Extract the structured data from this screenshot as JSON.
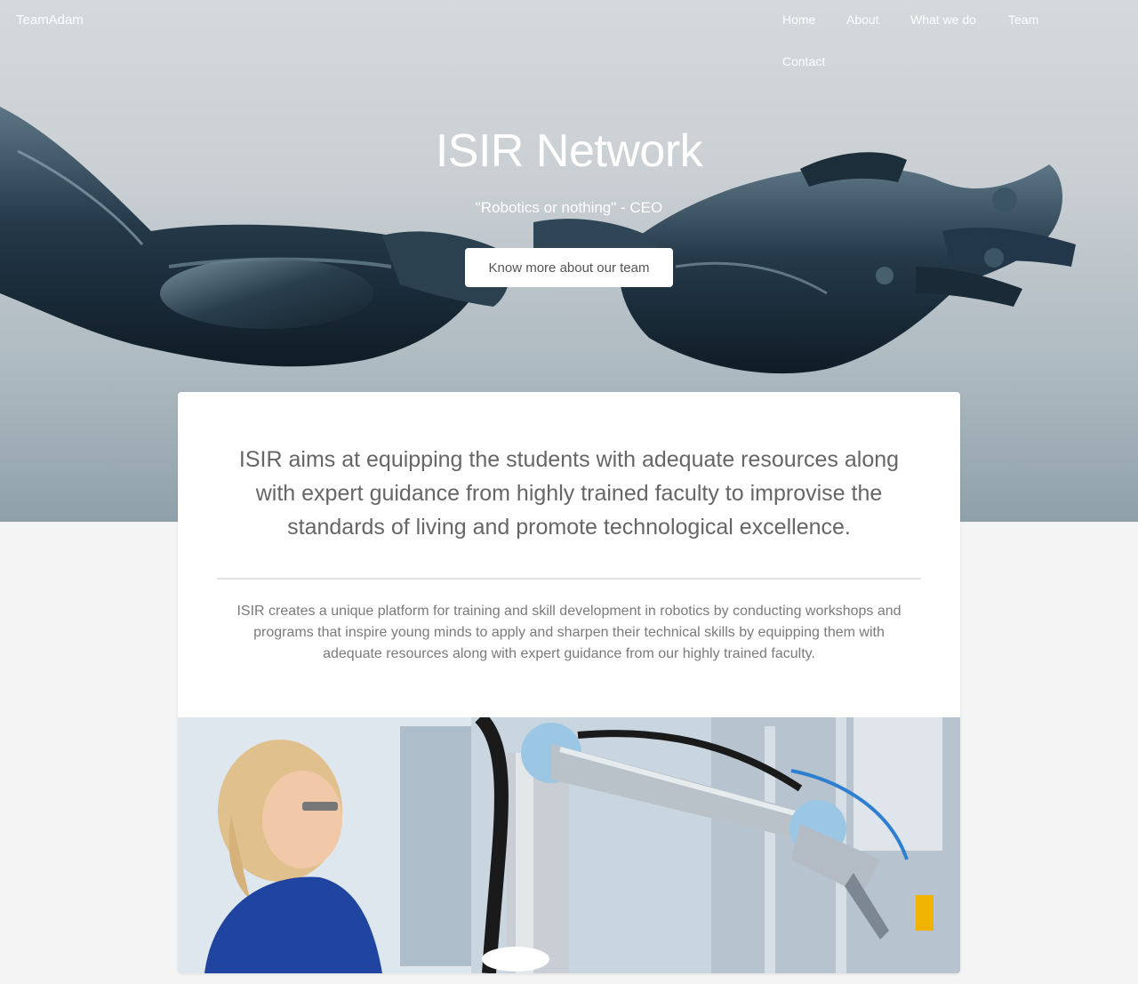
{
  "header": {
    "brand": "TeamAdam",
    "nav": [
      "Home",
      "About",
      "What we do",
      "Team",
      "Contact"
    ]
  },
  "hero": {
    "title": "ISIR Network",
    "quote": "\"Robotics or nothing\" - CEO",
    "button_label": "Know more about our team",
    "image_icon": "robotic-arms-image"
  },
  "about": {
    "lead": "ISIR aims at equipping the students with adequate resources along with expert guidance from highly trained faculty to improvise the standards of living and promote technological excellence.",
    "description": "ISIR creates a unique platform for training and skill development in robotics by conducting workshops and programs that inspire young minds to apply and sharpen their technical skills by equipping them with adequate resources along with expert guidance from our highly trained faculty.",
    "photo_icon": "robot-lab-photo"
  },
  "colors": {
    "hero_background": "#c9cfd3",
    "page_background": "#f4f4f4",
    "text_gray": "#666666",
    "robot_metal": "#2c4352"
  }
}
